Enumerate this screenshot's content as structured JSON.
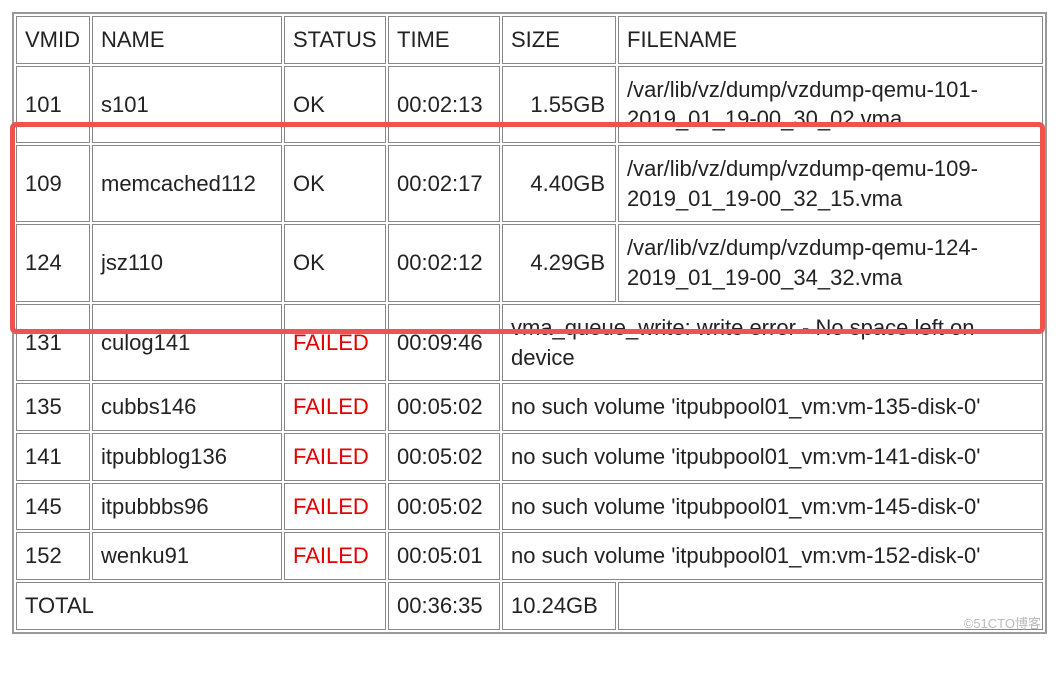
{
  "headers": {
    "vmid": "VMID",
    "name": "NAME",
    "status": "STATUS",
    "time": "TIME",
    "size": "SIZE",
    "filename": "FILENAME"
  },
  "rows": [
    {
      "vmid": "101",
      "name": "s101",
      "status": "OK",
      "time": "00:02:13",
      "size": "1.55GB",
      "filename": "/var/lib/vz/dump/vzdump-qemu-101-2019_01_19-00_30_02.vma"
    },
    {
      "vmid": "109",
      "name": "memcached112",
      "status": "OK",
      "time": "00:02:17",
      "size": "4.40GB",
      "filename": "/var/lib/vz/dump/vzdump-qemu-109-2019_01_19-00_32_15.vma"
    },
    {
      "vmid": "124",
      "name": "jsz110",
      "status": "OK",
      "time": "00:02:12",
      "size": "4.29GB",
      "filename": "/var/lib/vz/dump/vzdump-qemu-124-2019_01_19-00_34_32.vma"
    },
    {
      "vmid": "131",
      "name": "culog141",
      "status": "FAILED",
      "time": "00:09:46",
      "size": "",
      "filename": "vma_queue_write: write error - No space left on device"
    },
    {
      "vmid": "135",
      "name": "cubbs146",
      "status": "FAILED",
      "time": "00:05:02",
      "size": "",
      "filename": "no such volume 'itpubpool01_vm:vm-135-disk-0'"
    },
    {
      "vmid": "141",
      "name": "itpubblog136",
      "status": "FAILED",
      "time": "00:05:02",
      "size": "",
      "filename": "no such volume 'itpubpool01_vm:vm-141-disk-0'"
    },
    {
      "vmid": "145",
      "name": "itpubbbs96",
      "status": "FAILED",
      "time": "00:05:02",
      "size": "",
      "filename": "no such volume 'itpubpool01_vm:vm-145-disk-0'"
    },
    {
      "vmid": "152",
      "name": "wenku91",
      "status": "FAILED",
      "time": "00:05:01",
      "size": "",
      "filename": "no such volume 'itpubpool01_vm:vm-152-disk-0'"
    }
  ],
  "total": {
    "label": "TOTAL",
    "time": "00:36:35",
    "size": "10.24GB"
  },
  "watermark": "©51CTO博客"
}
